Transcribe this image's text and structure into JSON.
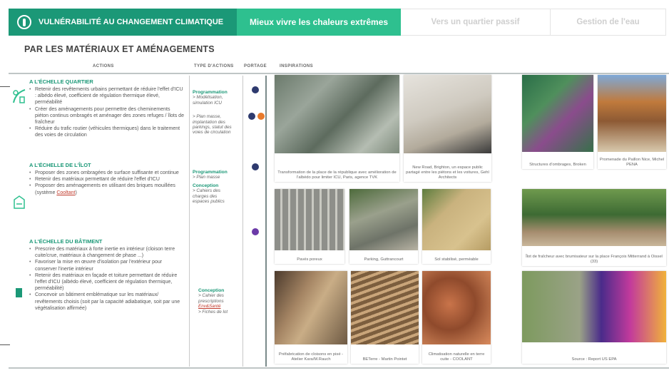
{
  "tabs": [
    {
      "label": "Vulnérabilité au changement climatique",
      "icon": "thermometer-icon"
    },
    {
      "label": "Mieux vivre les chaleurs extrêmes"
    },
    {
      "label": "Vers un quartier passif"
    },
    {
      "label": "Gestion de l'eau"
    }
  ],
  "title": "PAR LES MATÉRIAUX ET AMÉNAGEMENTS",
  "columns": {
    "actions": "ACTIONS",
    "type": "TYPE D'ACTIONS",
    "portage": "PORTAGE",
    "inspirations": "INSPIRATIONS"
  },
  "sections": [
    {
      "heading": "A l'échelle quartier",
      "bullets": [
        "Retenir des revêtements urbains permettant de réduire l'effet d'ICU : albédo élevé, coefficient de régulation thermique élevé, perméabilité",
        "Créer des aménagements pour permettre des cheminements piéton continus ombragés et aménager des zones refuges / îlots de fraîcheur",
        "Réduire du trafic routier (véhicules thermiques) dans le traitement des voies de circulation"
      ],
      "types": {
        "a_head": "Programmation",
        "a_lines": [
          "> Modélisation,",
          "simulation ICU"
        ],
        "b_lines": [
          "> Plan masse,",
          "implantation des",
          "parkings, statut des",
          "voies de circulation"
        ]
      }
    },
    {
      "heading": "A l'échelle de l'îlot",
      "bullets": [
        "Proposer des zones ombragées de surface suffisante et continue",
        "Retenir des matériaux permettant de réduire l'effet d'ICU",
        "Proposer des aménagements en utilisant des briques mouillées (système"
      ],
      "bullet3_link": "Cooltant",
      "bullet3_after": ")",
      "types": {
        "a_head": "Programmation",
        "a_lines": [
          "> Plan masse"
        ],
        "b_head": "Conception",
        "b_lines": [
          "> Cahiers des",
          "charges des",
          "espaces publics"
        ]
      }
    },
    {
      "heading": "A l'échelle du bâtiment",
      "bullets": [
        "Prescrire des matériaux à forte inertie en intérieur (cloison terre cuite/crue, matériaux à changement de phase ...)",
        "Favoriser la mise en œuvre d'isolation par l'extérieur pour conserver l'inertie intérieur",
        "Retenir des matériaux en façade et toiture permettant de réduire l'effet d'ICU (albédo élevé, coefficient de régulation thermique, perméabilité)",
        "Concevoir un bâtiment emblématique sur les matériaux/ revêtements choisis (soit par la capacité adiabatique, soit par une végétalisation affirmée)"
      ],
      "types": {
        "a_head": "Conception",
        "a_lines": [
          "> Cahier des",
          "prescriptions"
        ],
        "a_link": "Env&Santé",
        "b_lines": [
          "> Fiches de lot"
        ]
      }
    }
  ],
  "colors": {
    "dark_green": "#1b9877",
    "light_green": "#2ec08f",
    "navy_dot": "#2e3a6e",
    "orange_dot": "#e87a2c",
    "purple_dot": "#6b3aa8"
  },
  "inspirations": [
    {
      "caption": "Transformation de la place de la république avec amélioration de l'albédo pour limiter ICU, Paris, agence TVK"
    },
    {
      "caption": "New Road, Brighton, un espace public partagé entre les piétons et les voitures, Gehl Architects"
    },
    {
      "caption": "Structures d'ombrages, Broken"
    },
    {
      "caption": "Promenade du Paillon Nice, Michel PENA"
    },
    {
      "caption": "Pavés poreux"
    },
    {
      "caption": "Parking, Guttrancourt"
    },
    {
      "caption": "Sol stabilisé, perméable"
    },
    {
      "caption": "Îlot de fraîcheur avec brumisateur sur la place François Mitterrand à Oissel (33)"
    },
    {
      "caption": "Préfabrication de cloisons en pisé - Atelier Kara/M.Rauch"
    },
    {
      "caption": "BETerre - Martin Pointet"
    },
    {
      "caption": "Climatisation naturelle en terre cuite - COOLANT"
    },
    {
      "caption": "Source : Report US EPA"
    }
  ]
}
